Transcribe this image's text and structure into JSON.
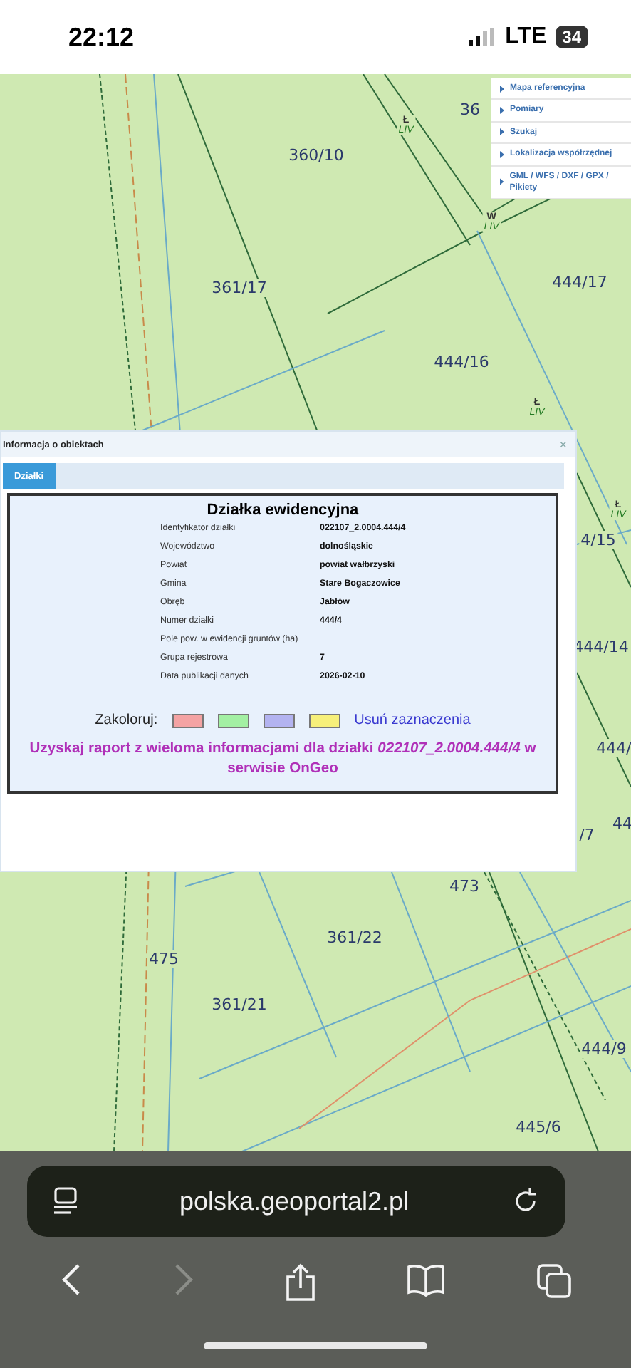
{
  "status_bar": {
    "time": "22:12",
    "network": "LTE",
    "battery": "34"
  },
  "map": {
    "parcels": [
      "36",
      "360/10",
      "361/17",
      "444/17",
      "444/16",
      "4/15",
      "444/14",
      "444/",
      "44",
      "/7",
      "473",
      "475",
      "361/22",
      "361/21",
      "444/9",
      "445/6"
    ],
    "land_use": [
      {
        "symbol": "Ł",
        "class": "LIV"
      },
      {
        "symbol": "W",
        "class": "LIV"
      },
      {
        "symbol": "Ł",
        "class": "LIV"
      },
      {
        "symbol": "Ł",
        "class": "LIV"
      }
    ],
    "menu": [
      "Mapa referencyjna",
      "Pomiary",
      "Szukaj",
      "Lokalizacja współrzędnej",
      "GML / WFS / DXF / GPX / Pikiety"
    ]
  },
  "dialog": {
    "title": "Informacja o obiektach",
    "close": "×",
    "tabs": [
      {
        "label": "Działki",
        "selected": true
      }
    ],
    "card": {
      "heading": "Działka ewidencyjna",
      "rows": [
        {
          "label": "Identyfikator działki",
          "value": "022107_2.0004.444/4"
        },
        {
          "label": "Województwo",
          "value": "dolnośląskie"
        },
        {
          "label": "Powiat",
          "value": "powiat wałbrzyski"
        },
        {
          "label": "Gmina",
          "value": "Stare Bogaczowice"
        },
        {
          "label": "Obręb",
          "value": "Jabłów"
        },
        {
          "label": "Numer działki",
          "value": "444/4"
        },
        {
          "label": "Pole pow. w ewidencji gruntów (ha)",
          "value": ""
        },
        {
          "label": "Grupa rejestrowa",
          "value": "7"
        },
        {
          "label": "Data publikacji danych",
          "value": "2026-02-10"
        }
      ],
      "color_label": "Zakoloruj:",
      "swatches": [
        {
          "color": "#f4a3a3"
        },
        {
          "color": "#a3f0a3"
        },
        {
          "color": "#b3b3f0"
        },
        {
          "color": "#f7f07a"
        }
      ],
      "clear_link": "Usuń zaznaczenia",
      "report_link": "Uzyskaj raport z wieloma informacjami dla działki *022107_2.0004.444/4* w serwisie OnGeo"
    }
  },
  "browser": {
    "url": "polska.geoportal2.pl",
    "forward_disabled": true
  }
}
